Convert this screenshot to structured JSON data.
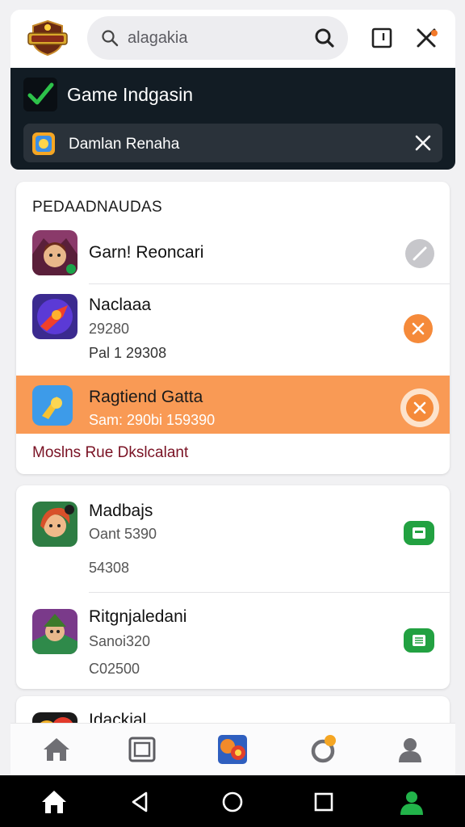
{
  "search": {
    "query": "alagakia"
  },
  "banner": {
    "title": "Game Indgasin",
    "subtitle": "Damlan Renaha"
  },
  "section1": {
    "heading": "PEDAADNAUDAS",
    "items": [
      {
        "name": "Garn! Reoncari"
      },
      {
        "name": "Naclaaa",
        "meta1": "29280",
        "meta2": "Pal 1 29308"
      },
      {
        "name": "Ragtiend Gatta",
        "meta1": "Sam: 290bi 159390"
      }
    ],
    "link": "Moslns Rue Dkslcalant"
  },
  "section2": {
    "items": [
      {
        "name": "Madbajs",
        "meta1": "Oant 5390",
        "meta2": "54308"
      },
      {
        "name": "Ritgnjaledani",
        "meta1": "Sanoi320",
        "meta2": "C02500"
      }
    ]
  },
  "section3": {
    "items": [
      {
        "name": "Idackial"
      }
    ]
  },
  "colors": {
    "accent": "#f99a55",
    "banner": "#121c24",
    "green": "#22a141",
    "link": "#7a1224"
  },
  "icons": {
    "topbar": [
      "app-logo",
      "search-icon",
      "qr-search-icon",
      "square-icon",
      "close-icon"
    ],
    "appnav": [
      "home-icon",
      "library-icon",
      "game-icon",
      "refresh-icon",
      "profile-icon"
    ],
    "sysnav": [
      "home-icon",
      "back-icon",
      "home-circle-icon",
      "recents-icon",
      "user-icon"
    ]
  }
}
